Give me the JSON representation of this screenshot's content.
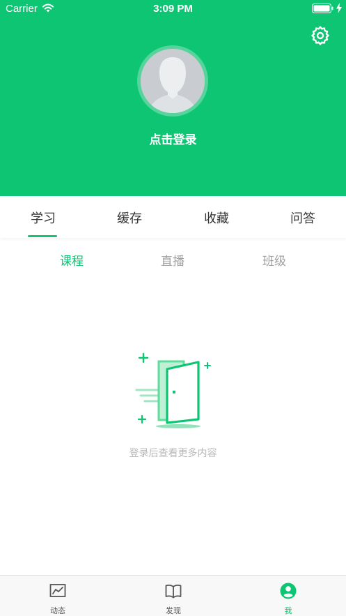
{
  "status_bar": {
    "carrier": "Carrier",
    "time": "3:09 PM"
  },
  "header": {
    "login_prompt": "点击登录",
    "background_color": "#0ec573",
    "settings_icon": "gear-icon"
  },
  "main_tabs": {
    "items": [
      {
        "label": "学习",
        "selected": true
      },
      {
        "label": "缓存",
        "selected": false
      },
      {
        "label": "收藏",
        "selected": false
      },
      {
        "label": "问答",
        "selected": false
      }
    ]
  },
  "sub_tabs": {
    "items": [
      {
        "label": "课程",
        "selected": true
      },
      {
        "label": "直播",
        "selected": false
      },
      {
        "label": "班级",
        "selected": false
      }
    ]
  },
  "empty_state": {
    "message": "登录后查看更多内容",
    "icon": "door-icon"
  },
  "tab_bar": {
    "items": [
      {
        "label": "动态",
        "icon": "chart-icon",
        "selected": false
      },
      {
        "label": "发现",
        "icon": "book-icon",
        "selected": false
      },
      {
        "label": "我",
        "icon": "profile-icon",
        "selected": true
      }
    ]
  },
  "colors": {
    "accent": "#0ec573",
    "text_primary": "#333333",
    "text_muted": "#a0a0a0"
  }
}
